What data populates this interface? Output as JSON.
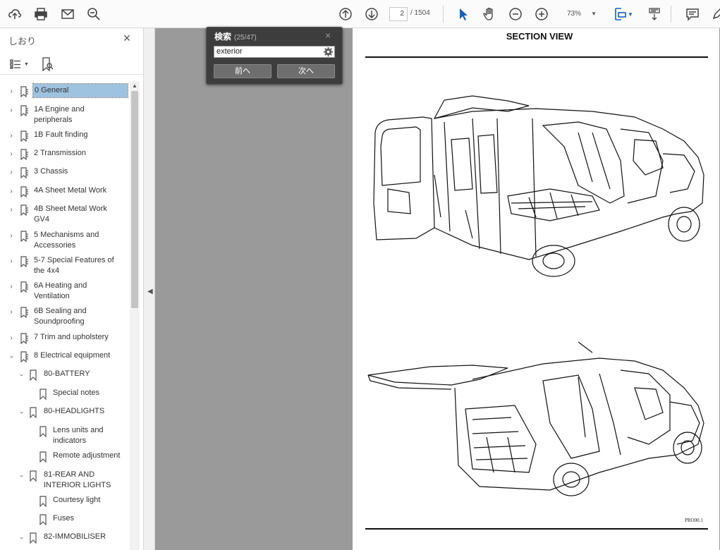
{
  "toolbar": {
    "page_current": "2",
    "page_total": "/ 1504",
    "zoom": "73%"
  },
  "sidebar": {
    "title": "しおり",
    "items": [
      {
        "label": "0 General"
      },
      {
        "label": "1A Engine and peripherals"
      },
      {
        "label": "1B Fault finding"
      },
      {
        "label": "2 Transmission"
      },
      {
        "label": "3 Chassis"
      },
      {
        "label": "4A Sheet Metal Work"
      },
      {
        "label": "4B Sheet Metal Work GV4"
      },
      {
        "label": "5 Mechanisms and Accessories"
      },
      {
        "label": "5-7 Special Features of the 4x4"
      },
      {
        "label": "6A Heating and Ventilation"
      },
      {
        "label": "6B Sealing and Soundproofing"
      },
      {
        "label": "7 Trim and upholstery"
      },
      {
        "label": "8 Electrical equipment"
      },
      {
        "label": "80-BATTERY"
      },
      {
        "label": "Special notes"
      },
      {
        "label": "80-HEADLIGHTS"
      },
      {
        "label": "Lens units and indicators"
      },
      {
        "label": "Remote adjustment"
      },
      {
        "label": "81-REAR AND INTERIOR LIGHTS"
      },
      {
        "label": "Courtesy light"
      },
      {
        "label": "Fuses"
      },
      {
        "label": "82-IMMOBILISER"
      }
    ]
  },
  "find": {
    "title": "検索",
    "count": "(25/47)",
    "query": "exterior",
    "prev_label": "前へ",
    "next_label": "次へ"
  },
  "document": {
    "heading": "SECTION VIEW",
    "code": "PRO00.1"
  }
}
